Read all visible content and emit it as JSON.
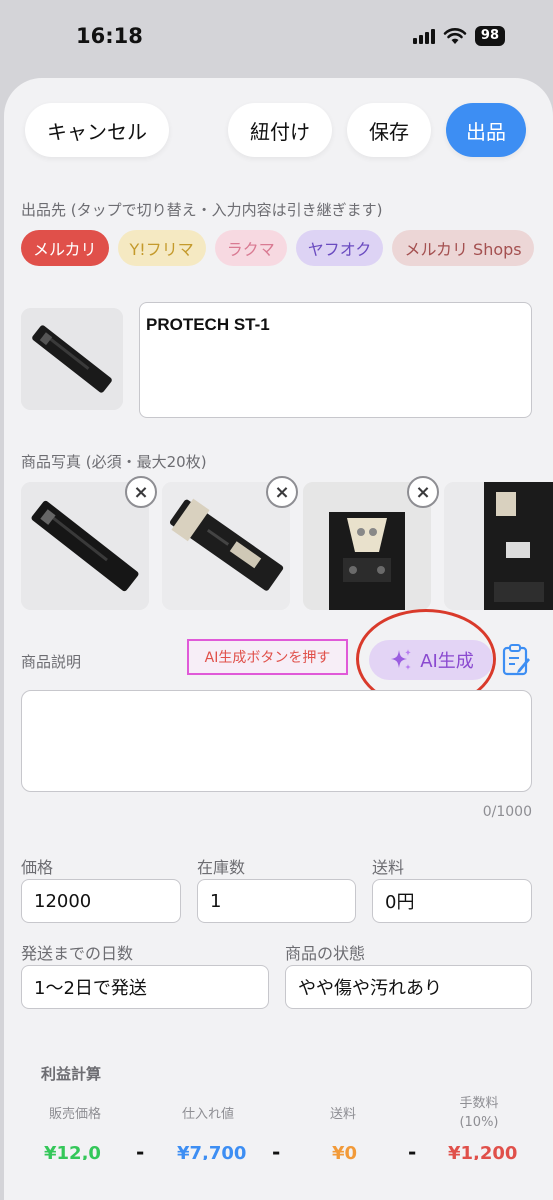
{
  "status_bar": {
    "time": "16:18",
    "battery": "98"
  },
  "header": {
    "cancel_label": "キャンセル",
    "link_label": "紐付け",
    "save_label": "保存",
    "publish_label": "出品"
  },
  "destination": {
    "label": "出品先 (タップで切り替え・入力内容は引き継ぎます)",
    "chips": [
      {
        "label": "メルカリ",
        "bg": "#e0504a",
        "fg": "#ffffff"
      },
      {
        "label": "Y!フリマ",
        "bg": "#f5e9c2",
        "fg": "#c49a2c"
      },
      {
        "label": "ラクマ",
        "bg": "#f7d9e1",
        "fg": "#d97a92"
      },
      {
        "label": "ヤフオク",
        "bg": "#ddd3f4",
        "fg": "#6a4bc0"
      },
      {
        "label": "メルカリ Shops",
        "bg": "#ecd6d6",
        "fg": "#a45050"
      }
    ]
  },
  "title_field": {
    "value": "PROTECH ST-1"
  },
  "photos": {
    "label": "商品写真 (必須・最大20枚)",
    "remove_icon": "×"
  },
  "description": {
    "label": "商品説明",
    "hint": "AI生成ボタンを押す",
    "ai_button_label": "AI生成",
    "value": "",
    "counter": "0/1000"
  },
  "price": {
    "label": "価格",
    "value": "12000"
  },
  "stock": {
    "label": "在庫数",
    "value": "1"
  },
  "shipping_fee": {
    "label": "送料",
    "value": "0円"
  },
  "shipping_days": {
    "label": "発送までの日数",
    "value": "1〜2日で発送"
  },
  "condition": {
    "label": "商品の状態",
    "value": "やや傷や汚れあり"
  },
  "profit": {
    "title": "利益計算",
    "columns": [
      {
        "label": "販売価格",
        "value": "¥12,0",
        "color": "#34c759"
      },
      {
        "label": "仕入れ値",
        "value": "¥7,700",
        "color": "#3d8ef3"
      },
      {
        "label": "送料",
        "value": "¥0",
        "color": "#f29a38"
      },
      {
        "label": "手数料\n(10%)",
        "value": "¥1,200",
        "color": "#e0504a"
      }
    ],
    "operator": "-"
  }
}
